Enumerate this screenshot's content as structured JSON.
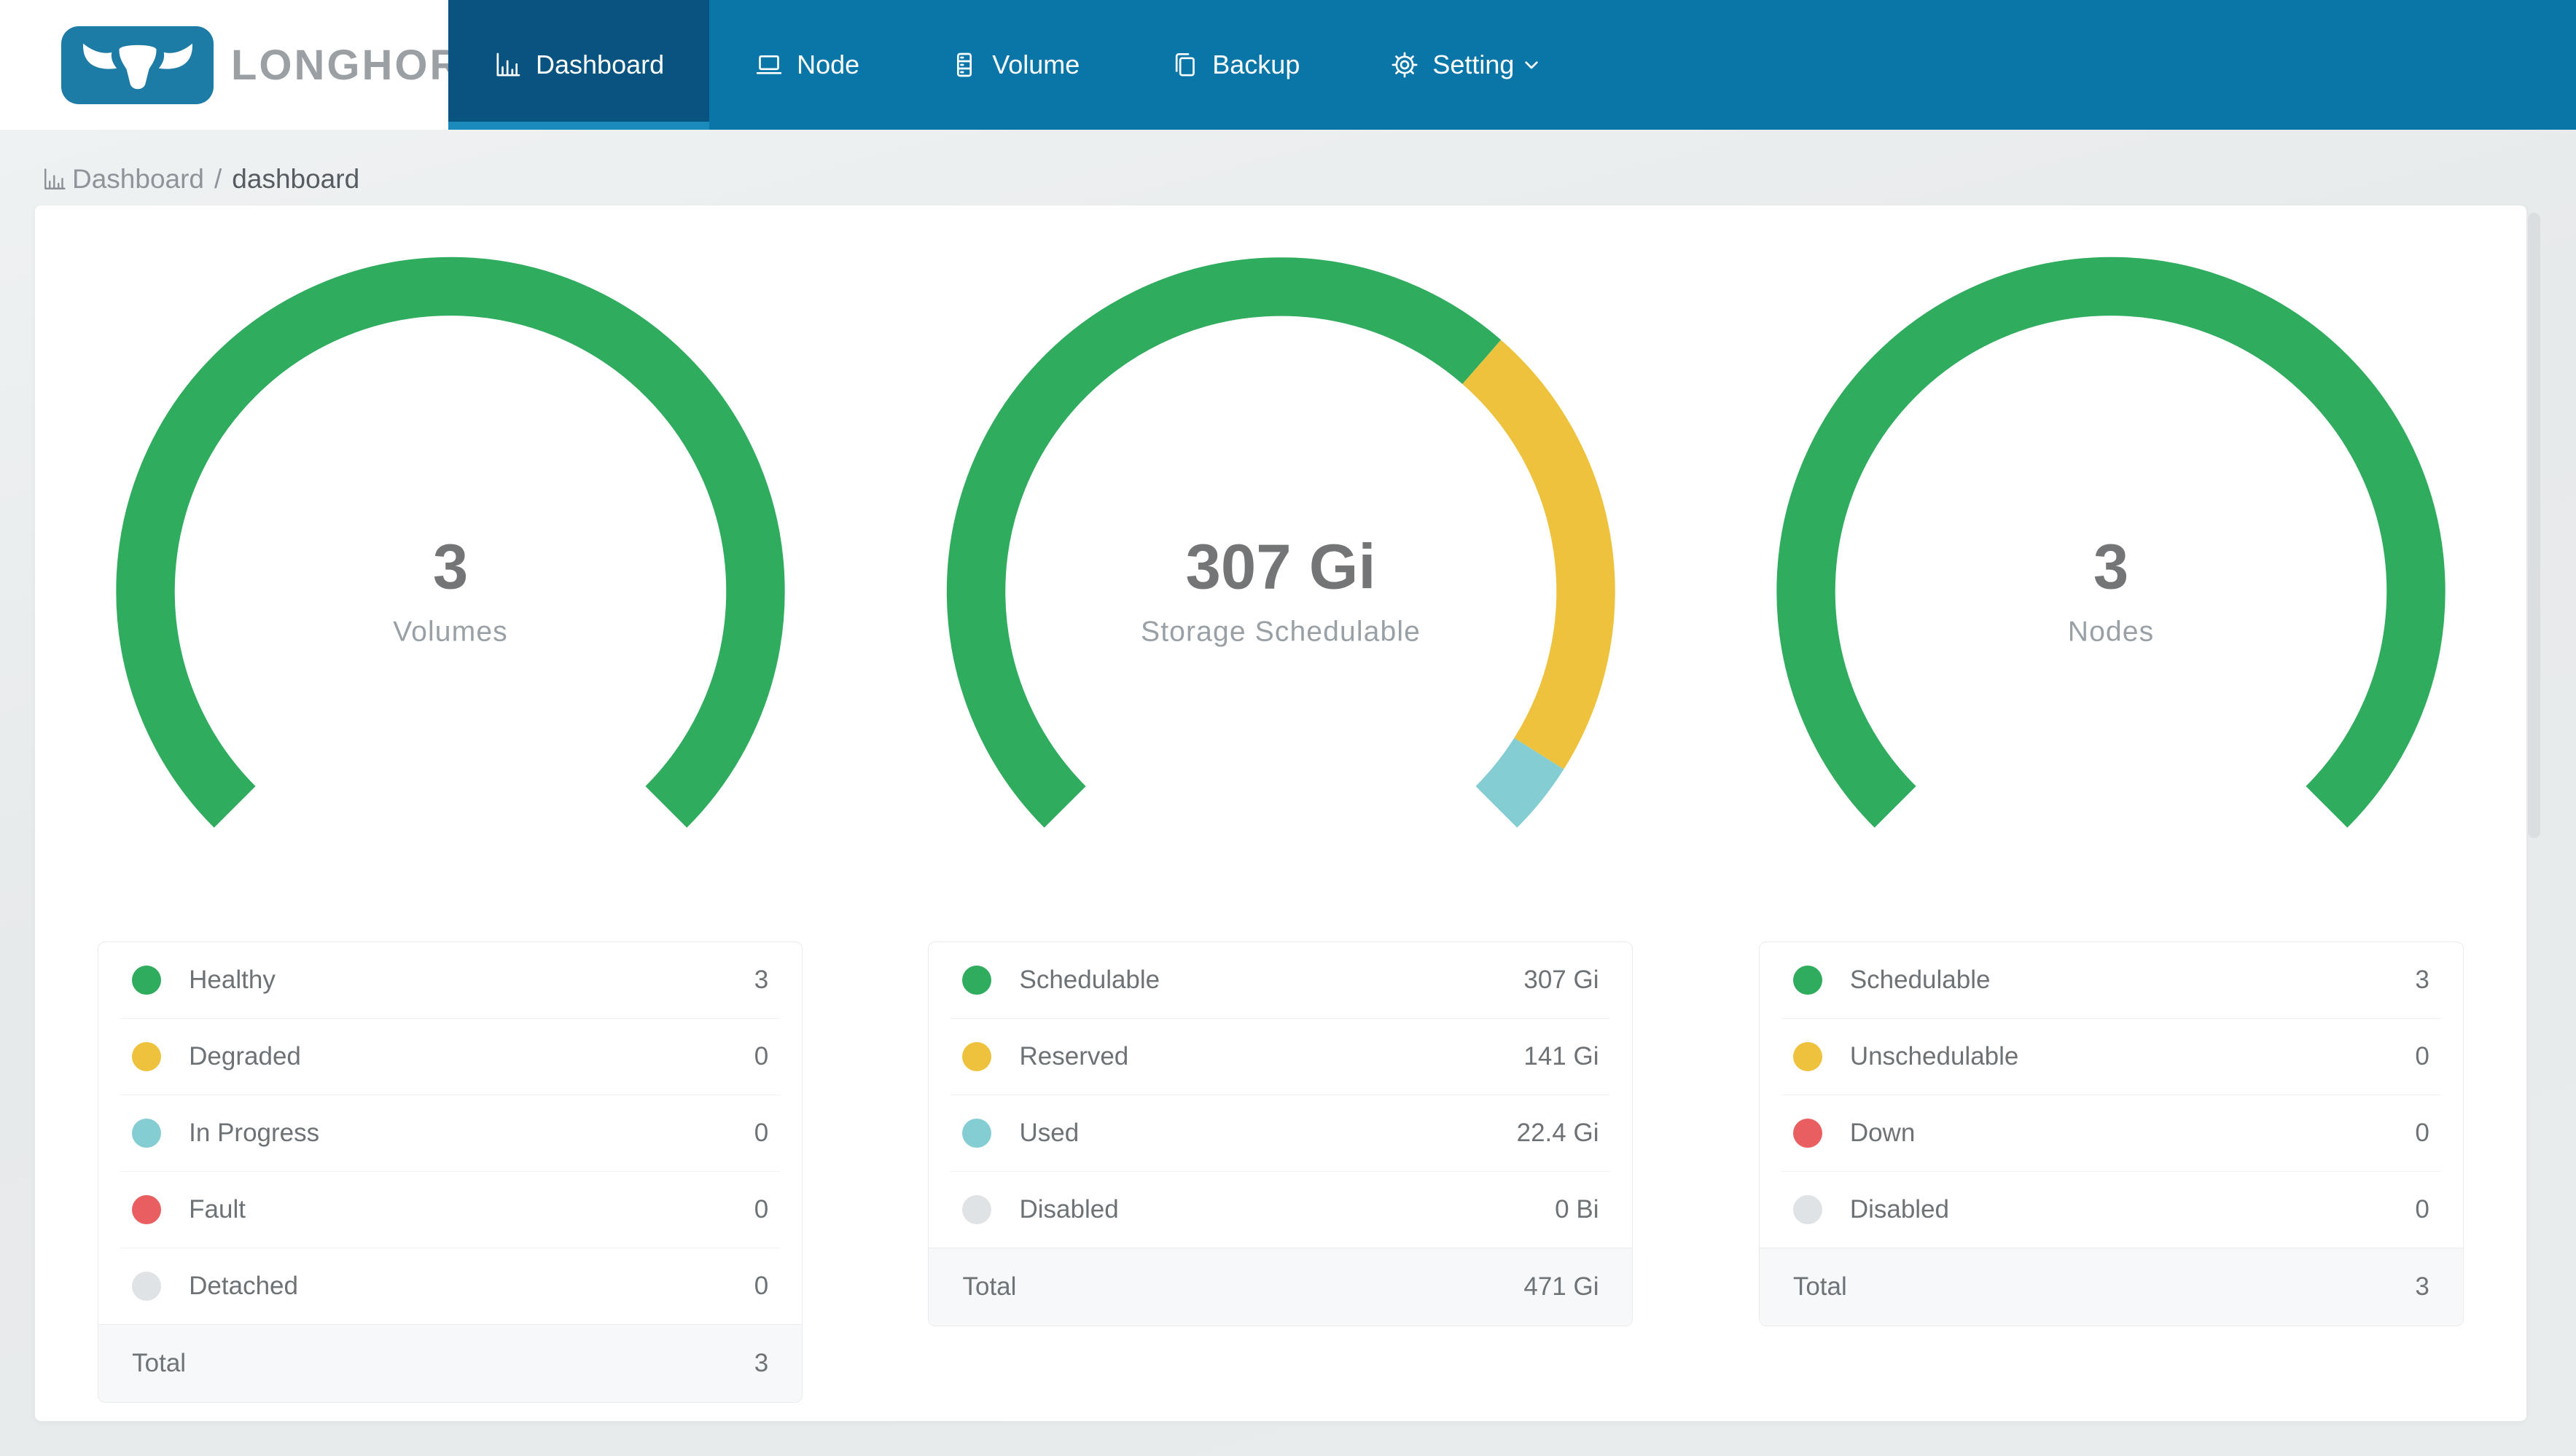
{
  "brand": {
    "name": "LONGHORN"
  },
  "nav": {
    "items": [
      {
        "label": "Dashboard",
        "icon": "bar-chart-icon",
        "active": true
      },
      {
        "label": "Node",
        "icon": "laptop-icon",
        "active": false
      },
      {
        "label": "Volume",
        "icon": "server-icon",
        "active": false
      },
      {
        "label": "Backup",
        "icon": "copy-icon",
        "active": false
      },
      {
        "label": "Setting",
        "icon": "gear-icon",
        "active": false,
        "dropdown": true
      }
    ]
  },
  "breadcrumb": {
    "icon": "bar-chart-icon",
    "section": "Dashboard",
    "separator": "/",
    "page": "dashboard"
  },
  "colors": {
    "navbar_bg": "#0a76a8",
    "active_tab_bg": "#085380",
    "active_tab_underline": "#1b8bbe",
    "logo_tile": "#1d7ca6",
    "green": "#30ac5f",
    "yellow": "#eec23c",
    "teal": "#83cdd3",
    "red": "#e95f5f",
    "gray": "#e0e3e5",
    "number_text": "#737577",
    "subtitle_text": "#99a1a6"
  },
  "chart_data": [
    {
      "type": "gauge-donut",
      "title": "3",
      "subtitle": "Volumes",
      "start_angle_deg": 135,
      "sweep_deg": 270,
      "segments": [
        {
          "label": "Healthy",
          "value": 3,
          "display": "3",
          "color": "#30ac5f"
        },
        {
          "label": "Degraded",
          "value": 0,
          "display": "0",
          "color": "#eec23c"
        },
        {
          "label": "In Progress",
          "value": 0,
          "display": "0",
          "color": "#83cdd3"
        },
        {
          "label": "Fault",
          "value": 0,
          "display": "0",
          "color": "#e95f5f"
        },
        {
          "label": "Detached",
          "value": 0,
          "display": "0",
          "color": "#e0e3e5"
        }
      ],
      "total": {
        "label": "Total",
        "display": "3"
      }
    },
    {
      "type": "gauge-donut",
      "title": "307 Gi",
      "subtitle": "Storage Schedulable",
      "start_angle_deg": 135,
      "sweep_deg": 270,
      "segments": [
        {
          "label": "Schedulable",
          "value": 307,
          "display": "307 Gi",
          "color": "#30ac5f"
        },
        {
          "label": "Reserved",
          "value": 141,
          "display": "141 Gi",
          "color": "#eec23c"
        },
        {
          "label": "Used",
          "value": 22.4,
          "display": "22.4 Gi",
          "color": "#83cdd3"
        },
        {
          "label": "Disabled",
          "value": 0,
          "display": "0 Bi",
          "color": "#e0e3e5"
        }
      ],
      "total": {
        "label": "Total",
        "display": "471 Gi"
      }
    },
    {
      "type": "gauge-donut",
      "title": "3",
      "subtitle": "Nodes",
      "start_angle_deg": 135,
      "sweep_deg": 270,
      "segments": [
        {
          "label": "Schedulable",
          "value": 3,
          "display": "3",
          "color": "#30ac5f"
        },
        {
          "label": "Unschedulable",
          "value": 0,
          "display": "0",
          "color": "#eec23c"
        },
        {
          "label": "Down",
          "value": 0,
          "display": "0",
          "color": "#e95f5f"
        },
        {
          "label": "Disabled",
          "value": 0,
          "display": "0",
          "color": "#e0e3e5"
        }
      ],
      "total": {
        "label": "Total",
        "display": "3"
      }
    }
  ]
}
